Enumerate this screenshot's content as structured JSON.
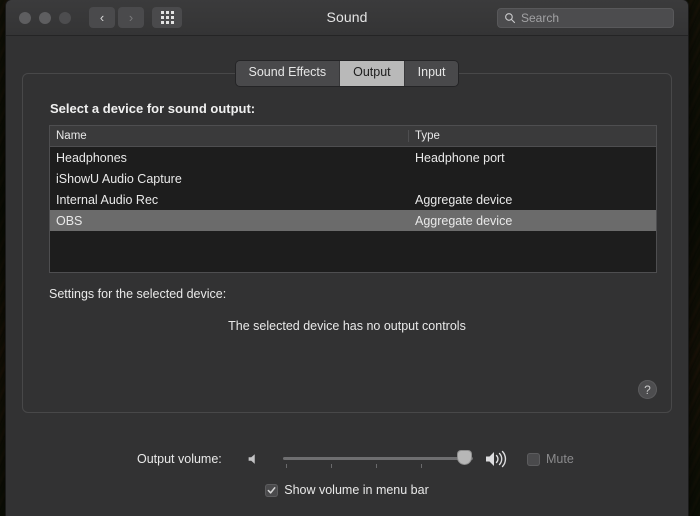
{
  "window": {
    "title": "Sound",
    "traffic_lights": [
      "close",
      "minimize",
      "zoom"
    ],
    "nav": {
      "back": "‹",
      "forward": "›",
      "grid_icon": "grid-icon"
    },
    "search": {
      "placeholder": "Search",
      "value": ""
    }
  },
  "tabs": [
    {
      "label": "Sound Effects",
      "active": false
    },
    {
      "label": "Output",
      "active": true
    },
    {
      "label": "Input",
      "active": false
    }
  ],
  "panel": {
    "title": "Select a device for sound output:",
    "settings_label": "Settings for the selected device:",
    "no_controls_message": "The selected device has no output controls",
    "help_label": "?"
  },
  "table": {
    "columns": [
      "Name",
      "Type"
    ],
    "rows": [
      {
        "name": "Headphones",
        "type": "Headphone port",
        "selected": false
      },
      {
        "name": "iShowU Audio Capture",
        "type": "",
        "selected": false
      },
      {
        "name": "Internal Audio Rec",
        "type": "Aggregate device",
        "selected": false
      },
      {
        "name": "OBS",
        "type": "Aggregate device",
        "selected": true
      }
    ]
  },
  "volume": {
    "label": "Output volume:",
    "slider_value": 95,
    "slider_min": 0,
    "slider_max": 100,
    "tick_count": 4,
    "mute": {
      "label": "Mute",
      "checked": false,
      "disabled": true
    },
    "show_in_menu_bar": {
      "label": "Show volume in menu bar",
      "checked": true
    }
  },
  "colors": {
    "window_bg": "#323233",
    "titlebar_bg": "#3b3b3c",
    "table_bg": "#1d1d1d",
    "row_selected": "#6b6b6b",
    "active_tab_bg": "#b9b9b9",
    "text": "#e9e9e9"
  }
}
